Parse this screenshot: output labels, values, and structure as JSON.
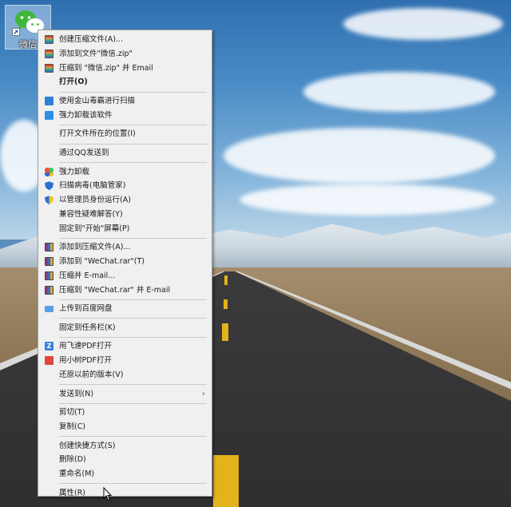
{
  "desktop": {
    "icon_label": "微信",
    "icon_name": "wechat-icon"
  },
  "context_menu": {
    "items": [
      {
        "label": "创建压缩文件(A)...",
        "icon": "winrar-icon",
        "bold": false
      },
      {
        "label": "添加到文件\"微信.zip\"",
        "icon": "winrar-icon",
        "bold": false
      },
      {
        "label": "压缩到 \"微信.zip\" 并 Email",
        "icon": "winrar-icon",
        "bold": false
      },
      {
        "label": "打开(O)",
        "icon": null,
        "bold": true
      },
      "sep",
      {
        "label": "使用金山毒霸进行扫描",
        "icon": "kingsoft-icon",
        "bold": false
      },
      {
        "label": "强力卸载该软件",
        "icon": "uninstall-icon",
        "bold": false
      },
      "sep",
      {
        "label": "打开文件所在的位置(I)",
        "icon": null,
        "bold": false
      },
      "sep",
      {
        "label": "通过QQ发送到",
        "icon": null,
        "bold": false
      },
      "sep",
      {
        "label": "强力卸载",
        "icon": "clover-icon",
        "bold": false
      },
      {
        "label": "扫描病毒(电脑管家)",
        "icon": "shield-icon",
        "bold": false
      },
      {
        "label": "以管理员身份运行(A)",
        "icon": "uac-shield-icon",
        "bold": false
      },
      {
        "label": "兼容性疑难解答(Y)",
        "icon": null,
        "bold": false
      },
      {
        "label": "固定到\"开始\"屏幕(P)",
        "icon": null,
        "bold": false
      },
      "sep",
      {
        "label": "添加到压缩文件(A)...",
        "icon": "winrar-archive-icon",
        "bold": false
      },
      {
        "label": "添加到 \"WeChat.rar\"(T)",
        "icon": "winrar-archive-icon",
        "bold": false
      },
      {
        "label": "压缩并 E-mail...",
        "icon": "winrar-archive-icon",
        "bold": false
      },
      {
        "label": "压缩到 \"WeChat.rar\" 并 E-mail",
        "icon": "winrar-archive-icon",
        "bold": false
      },
      "sep",
      {
        "label": "上传到百度网盘",
        "icon": "cloud-icon",
        "bold": false
      },
      "sep",
      {
        "label": "固定到任务栏(K)",
        "icon": null,
        "bold": false
      },
      "sep",
      {
        "label": "用飞速PDF打开",
        "icon": "pdf-z-icon",
        "bold": false
      },
      {
        "label": "用小树PDF打开",
        "icon": "pdf-red-icon",
        "bold": false
      },
      {
        "label": "还原以前的版本(V)",
        "icon": null,
        "bold": false
      },
      "sep",
      {
        "label": "发送到(N)",
        "icon": null,
        "bold": false,
        "submenu": true
      },
      "sep",
      {
        "label": "剪切(T)",
        "icon": null,
        "bold": false
      },
      {
        "label": "复制(C)",
        "icon": null,
        "bold": false
      },
      "sep",
      {
        "label": "创建快捷方式(S)",
        "icon": null,
        "bold": false
      },
      {
        "label": "删除(D)",
        "icon": null,
        "bold": false
      },
      {
        "label": "重命名(M)",
        "icon": null,
        "bold": false
      },
      "sep",
      {
        "label": "属性(R)",
        "icon": null,
        "bold": false
      }
    ],
    "submenu_glyph": "›",
    "pdf_z_glyph": "Z"
  }
}
